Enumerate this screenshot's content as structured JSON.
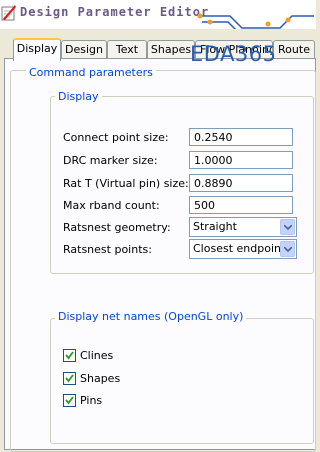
{
  "window": {
    "title": "Design Parameter Editor",
    "watermark": "EDA365"
  },
  "tabs": [
    {
      "label": "Display",
      "active": true
    },
    {
      "label": "Design"
    },
    {
      "label": "Text"
    },
    {
      "label": "Shapes"
    },
    {
      "label": "Flow Planning"
    },
    {
      "label": "Route"
    }
  ],
  "command_parameters": {
    "title": "Command parameters",
    "display": {
      "title": "Display",
      "rows": [
        {
          "label": "Connect point size:",
          "value": "0.2540"
        },
        {
          "label": "DRC marker size:",
          "value": "1.0000"
        },
        {
          "label": "Rat T (Virtual pin) size:",
          "value": "0.8890"
        },
        {
          "label": "Max rband count:",
          "value": "500"
        }
      ],
      "selects": [
        {
          "label": "Ratsnest geometry:",
          "value": "Straight"
        },
        {
          "label": "Ratsnest points:",
          "value": "Closest endpoint"
        }
      ]
    },
    "net_names": {
      "title": "Display net names (OpenGL only)",
      "items": [
        {
          "label": "Clines",
          "checked": true
        },
        {
          "label": "Shapes",
          "checked": true
        },
        {
          "label": "Pins",
          "checked": true
        }
      ]
    }
  },
  "colors": {
    "group_title": "#0046d5",
    "active_tab_accent": "#ffc83c",
    "watermark": "#2a5db0"
  }
}
